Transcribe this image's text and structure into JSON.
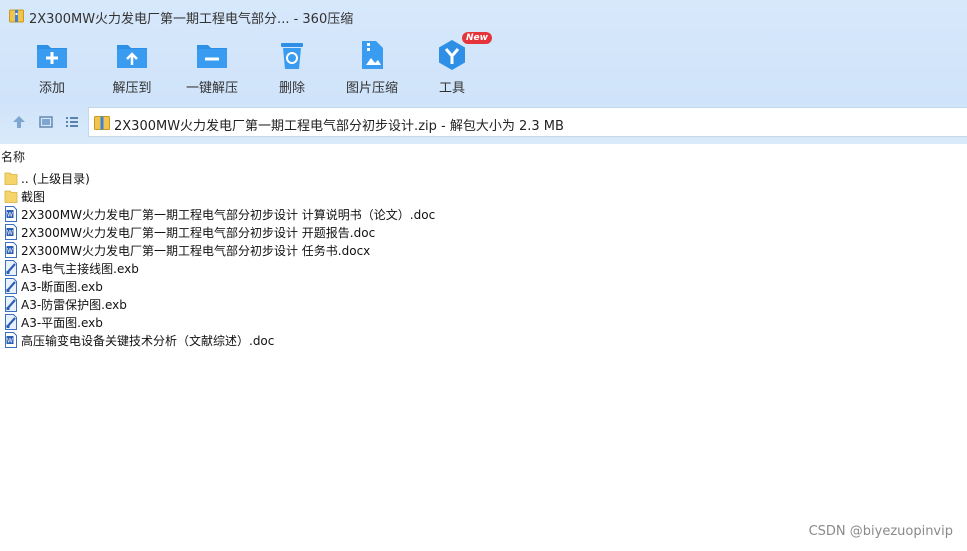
{
  "window": {
    "title": "2X300MW火力发电厂第一期工程电气部分... - 360压缩"
  },
  "toolbar": {
    "items": [
      {
        "label": "添加",
        "icon": "add-folder-icon"
      },
      {
        "label": "解压到",
        "icon": "extract-to-icon"
      },
      {
        "label": "一键解压",
        "icon": "one-click-extract-icon"
      },
      {
        "label": "删除",
        "icon": "trash-icon"
      },
      {
        "label": "图片压缩",
        "icon": "image-compress-icon"
      },
      {
        "label": "工具",
        "icon": "tools-icon",
        "badge": "New"
      }
    ]
  },
  "address": {
    "path": "2X300MW火力发电厂第一期工程电气部分初步设计.zip - 解包大小为 2.3 MB"
  },
  "list": {
    "column_name": "名称",
    "items": [
      {
        "name": ".. (上级目录)",
        "type": "folder"
      },
      {
        "name": "截图",
        "type": "folder"
      },
      {
        "name": "2X300MW火力发电厂第一期工程电气部分初步设计 计算说明书（论文）.doc",
        "type": "word"
      },
      {
        "name": "2X300MW火力发电厂第一期工程电气部分初步设计 开题报告.doc",
        "type": "word"
      },
      {
        "name": "2X300MW火力发电厂第一期工程电气部分初步设计 任务书.docx",
        "type": "word"
      },
      {
        "name": "A3-电气主接线图.exb",
        "type": "exb"
      },
      {
        "name": "A3-断面图.exb",
        "type": "exb"
      },
      {
        "name": "A3-防雷保护图.exb",
        "type": "exb"
      },
      {
        "name": "A3-平面图.exb",
        "type": "exb"
      },
      {
        "name": "高压输变电设备关键技术分析（文献综述）.doc",
        "type": "word"
      }
    ]
  },
  "watermark": "CSDN @biyezuopinvip",
  "colors": {
    "chrome": "#d3e6fb",
    "icon_blue": "#2f8fe6",
    "folder": "#f7d46a",
    "badge": "#e5353a"
  }
}
